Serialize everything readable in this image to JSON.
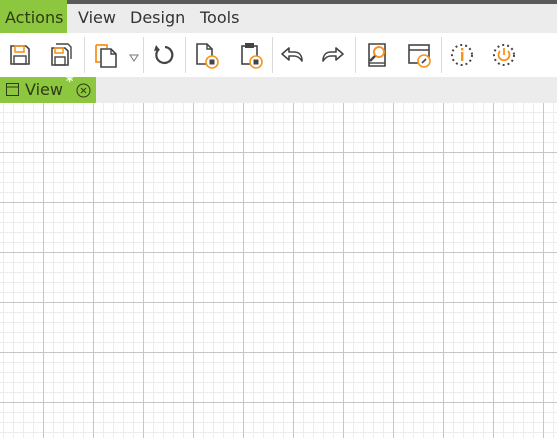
{
  "menubar": {
    "items": [
      {
        "label": "Actions",
        "active": true
      },
      {
        "label": "View",
        "active": false
      },
      {
        "label": "Design",
        "active": false
      },
      {
        "label": "Tools",
        "active": false
      }
    ]
  },
  "toolbar": {
    "buttons": [
      {
        "icon": "save-icon"
      },
      {
        "icon": "save-as-icon"
      },
      {
        "icon": "new-document-icon"
      },
      {
        "icon": "dropdown-arrow-icon"
      },
      {
        "icon": "refresh-icon"
      },
      {
        "icon": "export-document-icon"
      },
      {
        "icon": "clipboard-icon"
      },
      {
        "icon": "undo-icon"
      },
      {
        "icon": "redo-icon"
      },
      {
        "icon": "search-document-icon"
      },
      {
        "icon": "window-settings-icon"
      },
      {
        "icon": "info-icon"
      },
      {
        "icon": "power-icon"
      }
    ]
  },
  "tabs": [
    {
      "label": "View",
      "modified_marker": "*",
      "active": true
    }
  ],
  "colors": {
    "accent": "#8dc63f",
    "icon_orange": "#f7941d",
    "icon_dark": "#444444",
    "menubar_bg": "#ececec",
    "grid_major": "#c6c6c6",
    "grid_minor": "#ececec"
  }
}
